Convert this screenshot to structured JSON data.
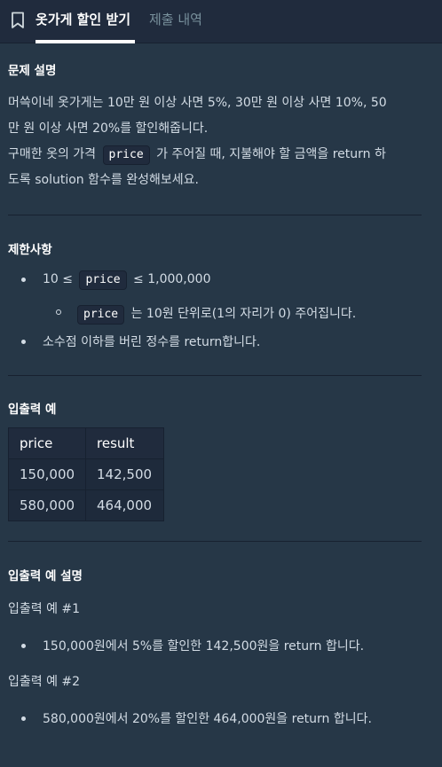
{
  "tabs": {
    "active": "옷가게 할인 받기",
    "inactive": "제출 내역"
  },
  "problem": {
    "heading": "문제 설명",
    "line1": "머쓱이네 옷가게는 10만 원 이상 사면 5%, 30만 원 이상 사면 10%, 50",
    "line2": "만 원 이상 사면 20%를 할인해줍니다.",
    "line3_before": "구매한 옷의 가격",
    "line3_code": "price",
    "line3_after": "가 주어질 때, 지불해야 할 금액을 return 하",
    "line4": "도록 solution 함수를 완성해보세요."
  },
  "constraints": {
    "heading": "제한사항",
    "item1_before": "10 ≤",
    "item1_code": "price",
    "item1_after": "≤ 1,000,000",
    "sub1_code": "price",
    "sub1_after": "는 10원 단위로(1의 자리가 0) 주어집니다.",
    "item2": "소수점 이하를 버린 정수를 return합니다."
  },
  "examples": {
    "heading": "입출력 예",
    "columns": [
      "price",
      "result"
    ],
    "rows": [
      [
        "150,000",
        "142,500"
      ],
      [
        "580,000",
        "464,000"
      ]
    ]
  },
  "explanation": {
    "heading": "입출력 예 설명",
    "ex1_title": "입출력 예 #1",
    "ex1_item": "150,000원에서 5%를 할인한 142,500원을 return 합니다.",
    "ex2_title": "입출력 예 #2",
    "ex2_item": "580,000원에서 20%를 할인한 464,000원을 return 합니다."
  },
  "colors": {
    "background": "#263747",
    "header": "#202b3d",
    "text": "#d3dce5",
    "heading": "#ffffff",
    "inactive_tab": "#78909c"
  },
  "icons": {
    "tab_icon": "bookmark-icon"
  }
}
